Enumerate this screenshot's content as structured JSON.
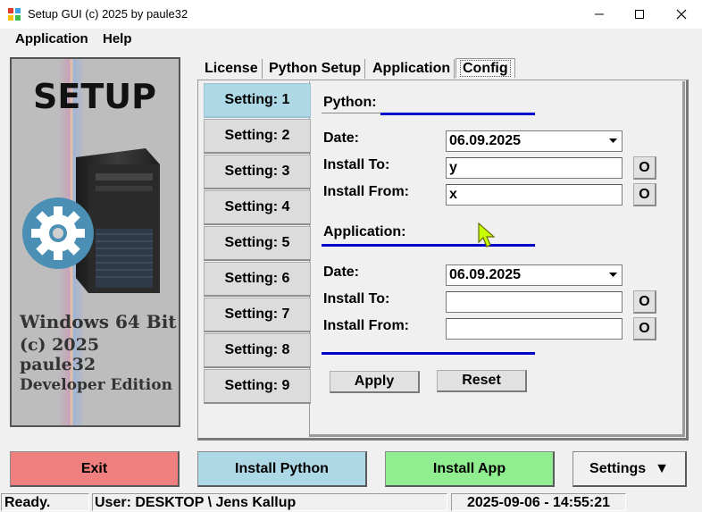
{
  "window": {
    "title": "Setup GUI (c) 2025 by paule32",
    "minimize": "—",
    "maximize": "☐",
    "close": "✕"
  },
  "menu": {
    "items": [
      "Application",
      "Help"
    ]
  },
  "left_panel": {
    "heading": "SETUP",
    "line1": "Windows 64 Bit",
    "line2": "(c) 2025 paule32",
    "line3": "Developer Edition"
  },
  "tabs": [
    "License",
    "Python Setup",
    "Application",
    "Config"
  ],
  "active_tab": "Config",
  "settings_buttons": [
    "Setting: 1",
    "Setting: 2",
    "Setting: 3",
    "Setting: 4",
    "Setting: 5",
    "Setting: 6",
    "Setting: 7",
    "Setting: 8",
    "Setting: 9"
  ],
  "python_section": {
    "title": "Python:",
    "date_label": "Date:",
    "date_value": "06.09.2025",
    "install_to_label": "Install To:",
    "install_to_value": "y",
    "install_from_label": "Install From:",
    "install_from_value": "x",
    "open_label": "O"
  },
  "application_section": {
    "title": "Application:",
    "date_label": "Date:",
    "date_value": "06.09.2025",
    "install_to_label": "Install To:",
    "install_to_value": "",
    "install_from_label": "Install From:",
    "install_from_value": "",
    "open_label": "O"
  },
  "actions": {
    "apply": "Apply",
    "reset": "Reset"
  },
  "bottom_buttons": {
    "exit": "Exit",
    "install_python": "Install Python",
    "install_app": "Install App",
    "settings": "Settings",
    "settings_arrow": "▼"
  },
  "status": {
    "state": "Ready.",
    "user": "User:  DESKTOP \\ Jens Kallup",
    "datetime": "2025-09-06  -  14:55:21"
  },
  "colors": {
    "accent_rule": "#0000cc",
    "active_setting": "#add8e6",
    "exit": "#f08080",
    "install_python": "#add8e6",
    "install_app": "#90ee90"
  }
}
